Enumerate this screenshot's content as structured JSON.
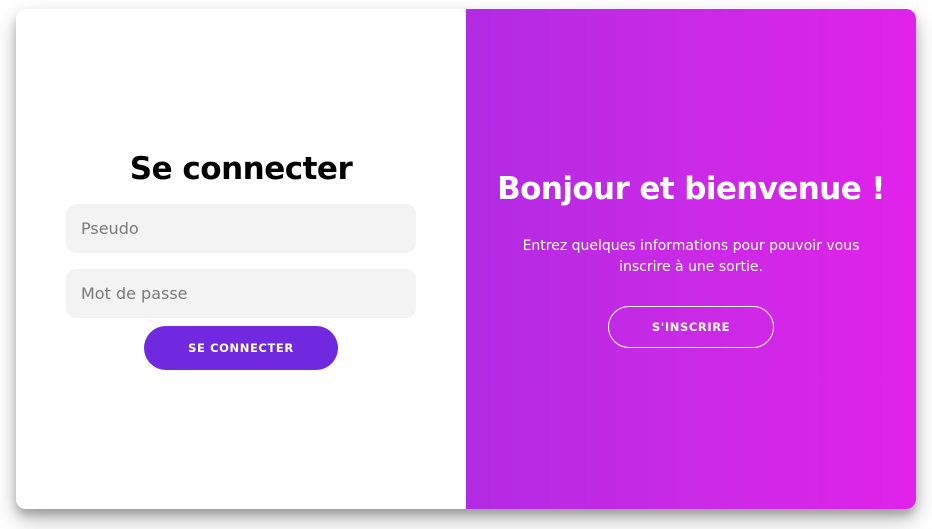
{
  "login": {
    "title": "Se connecter",
    "pseudo_placeholder": "Pseudo",
    "password_placeholder": "Mot de passe",
    "submit_label": "SE CONNECTER"
  },
  "welcome": {
    "title": "Bonjour et bienvenue !",
    "subtitle": "Entrez quelques informations pour pouvoir vous inscrire à une sortie.",
    "signup_label": "S'INSCRIRE"
  },
  "colors": {
    "primary_button": "#7129e0",
    "gradient_start": "#b22ae3",
    "gradient_end": "#e122ea",
    "input_background": "#f3f3f3"
  }
}
